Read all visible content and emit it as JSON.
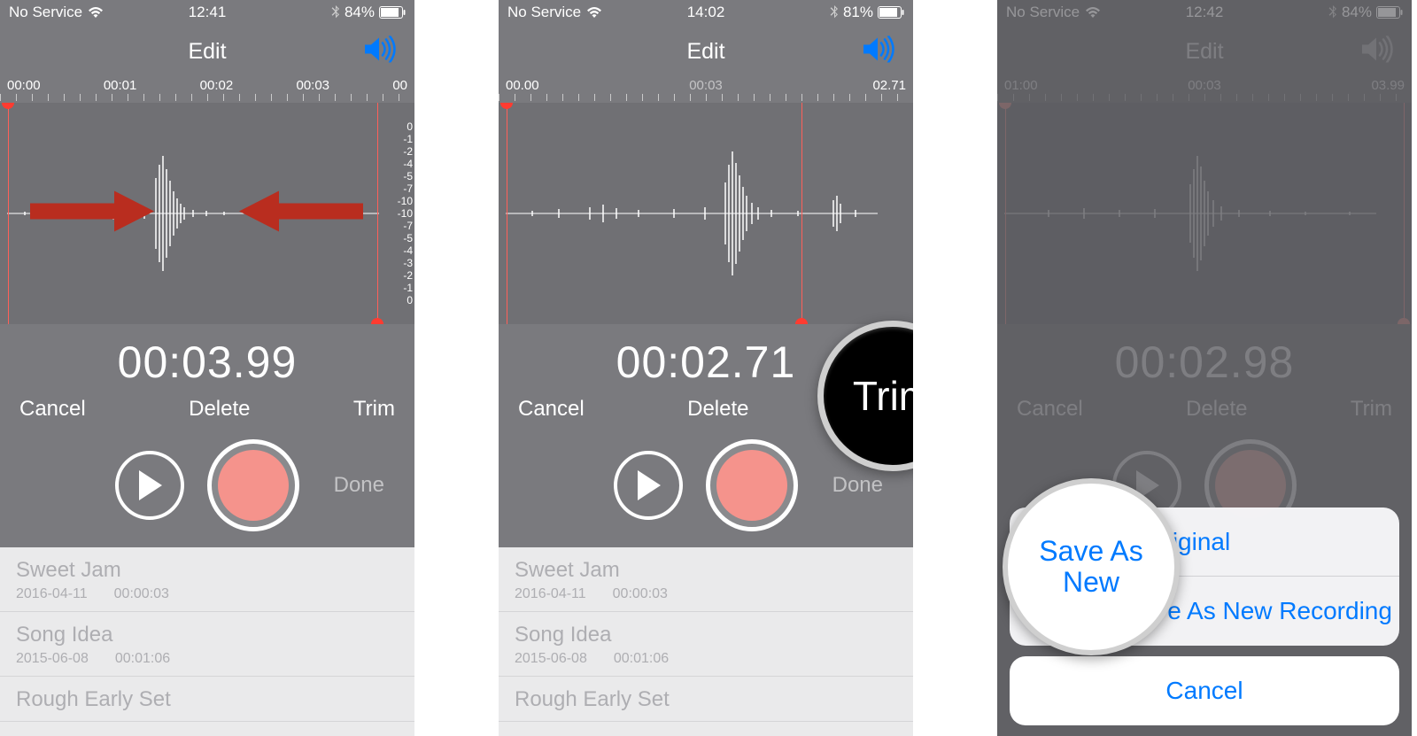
{
  "colors": {
    "blue": "#007aff",
    "red": "#ff3b30",
    "light_red": "#f5938c",
    "arrow_red": "#b92d1f"
  },
  "phones": [
    {
      "status": {
        "carrier": "No Service",
        "time": "12:41",
        "battery": "84%"
      },
      "header": "Edit",
      "ruler_mode": "evenly",
      "ruler": [
        "00:00",
        "00:01",
        "00:02",
        "00:03",
        "00"
      ],
      "db_scale": [
        "0",
        "-1",
        "-2",
        "-3",
        "-4",
        "-5",
        "-7",
        "-10",
        "-10",
        "-7",
        "-5",
        "-4",
        "-3",
        "-2",
        "-1",
        "0"
      ],
      "time": "00:03.99",
      "actions": {
        "cancel": "Cancel",
        "delete": "Delete",
        "trim": "Trim"
      },
      "done": "Done",
      "recordings": [
        {
          "title": "Sweet Jam",
          "date": "2016-04-11",
          "dur": "00:00:03"
        },
        {
          "title": "Song Idea",
          "date": "2015-06-08",
          "dur": "00:01:06"
        },
        {
          "title": "Rough Early Set",
          "date": "",
          "dur": ""
        }
      ],
      "trim_left_pct": 2,
      "trim_right_pct": 91,
      "show_arrows": true,
      "show_db_scale": true
    },
    {
      "status": {
        "carrier": "No Service",
        "time": "14:02",
        "battery": "81%"
      },
      "header": "Edit",
      "ruler_mode": "spaced",
      "ruler": [
        "00.00",
        "00:03",
        "02.71"
      ],
      "time": "00:02.71",
      "actions": {
        "cancel": "Cancel",
        "delete": "Delete",
        "trim": "Trim"
      },
      "done": "Done",
      "recordings": [
        {
          "title": "Sweet Jam",
          "date": "2016-04-11",
          "dur": "00:00:03"
        },
        {
          "title": "Song Idea",
          "date": "2015-06-08",
          "dur": "00:01:06"
        },
        {
          "title": "Rough Early Set",
          "date": "",
          "dur": ""
        }
      ],
      "trim_left_pct": 2,
      "trim_right_pct": 98,
      "show_arrows": false,
      "show_db_scale": false,
      "callout": "Trim"
    },
    {
      "status": {
        "carrier": "No Service",
        "time": "12:42",
        "battery": "84%"
      },
      "header": "Edit",
      "ruler_mode": "spaced",
      "ruler": [
        "01:00",
        "00:03",
        "03.99"
      ],
      "time": "00:02.98",
      "actions": {
        "cancel": "Cancel",
        "delete": "Delete",
        "trim": "Trim"
      },
      "done": "Done",
      "trim_left_pct": 2,
      "trim_right_pct": 98,
      "show_arrows": false,
      "show_db_scale": false,
      "dimmed": true,
      "sheet": {
        "opt1": "Trim Original",
        "opt2": "Save As New Recording",
        "cancel": "Cancel"
      },
      "callout_save": "Save As New"
    }
  ]
}
